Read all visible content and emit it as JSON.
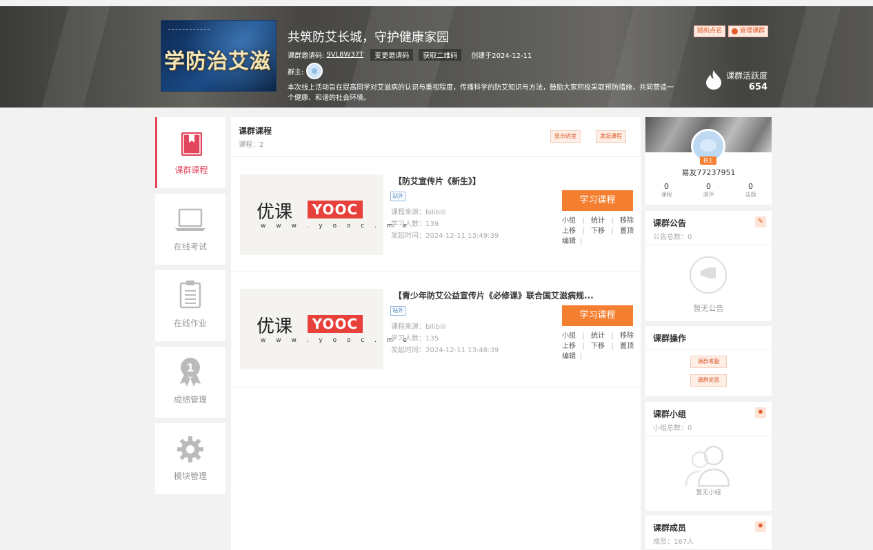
{
  "banner": {
    "cover_text": "学防治艾滋",
    "title": "共筑防艾长城，守护健康家园",
    "invite_label": "课群邀请码:",
    "invite_code": "9VL8W37T",
    "change_invite": "变更邀请码",
    "get_qr": "获取二维码",
    "created": "创建于2024-12-11",
    "owner_label": "群主:",
    "description": "本次线上活动旨在提高同学对艾滋病的认识与重视程度，传播科学的防艾知识与方法，鼓励大家积极采取预防措施，共同营造一个健康、和谐的社会环境。",
    "random_roll": "随机点名",
    "manage": "管理课群",
    "activity_label": "课群活跃度",
    "activity_value": "654"
  },
  "nav": {
    "items": [
      {
        "label": "课群课程"
      },
      {
        "label": "在线考试"
      },
      {
        "label": "在线作业"
      },
      {
        "label": "成绩管理"
      },
      {
        "label": "模块管理"
      }
    ]
  },
  "main": {
    "title": "课群课程",
    "count": "课程：2",
    "show_progress": "显示进度",
    "start_course": "发起课程",
    "courses": [
      {
        "thumb_text": "优课",
        "thumb_brand": "YOOC",
        "thumb_url": "w w w . y o o c . m e",
        "title": "【防艾宣传片《新生》】",
        "tag": "站外",
        "source": "课程来源：bilibili",
        "learners": "学习人数：139",
        "time": "发起时间：2024-12-11 13:49:39",
        "learn_btn": "学习课程"
      },
      {
        "thumb_text": "优课",
        "thumb_brand": "YOOC",
        "thumb_url": "w w w . y o o c . m e",
        "title": "【青少年防艾公益宣传片《必修课》联合国艾滋病规...",
        "tag": "站外",
        "source": "课程来源：bilibili",
        "learners": "学习人数：135",
        "time": "发起时间：2024-12-11 13:48:39",
        "learn_btn": "学习课程"
      }
    ],
    "ops": {
      "group": "小组",
      "stats": "统计",
      "move": "移除",
      "up": "上移",
      "down": "下移",
      "top": "置顶",
      "edit": "编辑",
      "sep": "|"
    }
  },
  "profile": {
    "badge": "群主",
    "name": "易友77237951",
    "stats": [
      {
        "n": "0",
        "l": "课程"
      },
      {
        "n": "0",
        "l": "测评"
      },
      {
        "n": "0",
        "l": "话题"
      }
    ]
  },
  "notice": {
    "title": "课群公告",
    "count": "公告总数：0",
    "empty": "暂无公告"
  },
  "ops_card": {
    "title": "课群操作",
    "attendance": "课群考勤",
    "awards": "课群奖惩"
  },
  "groups": {
    "title": "课群小组",
    "count": "小组总数：0",
    "empty": "暂无小组"
  },
  "members": {
    "title": "课群成员",
    "count": "成员：167人"
  },
  "colors": {
    "accent": "#f47f30",
    "nav_active": "#e0475f"
  }
}
